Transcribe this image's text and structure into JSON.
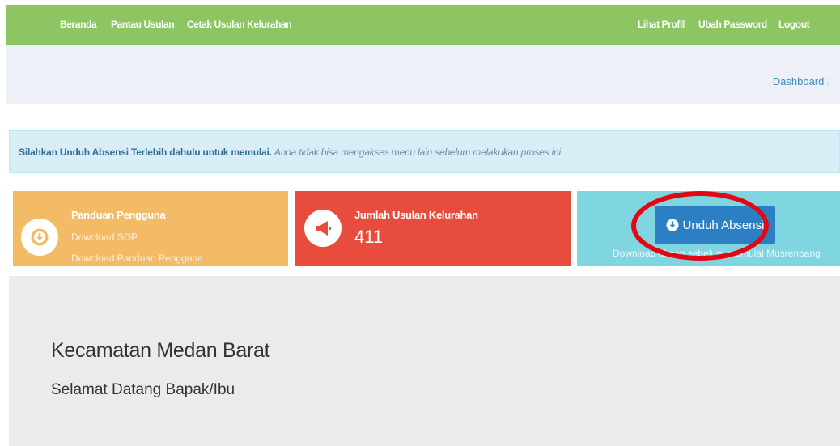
{
  "nav": {
    "left": [
      "Beranda",
      "Pantau Usulan",
      "Cetak Usulan Kelurahan"
    ],
    "right": [
      "Lihat Profil",
      "Ubah Password",
      "Logout"
    ]
  },
  "breadcrumb": {
    "current": "Dashboard",
    "separator": "/"
  },
  "alert": {
    "strong": "Silahkan Unduh Absensi Terlebih dahulu untuk memulai.",
    "note": "Anda tidak bisa mengakses menu lain sebelum melakukan proses ini"
  },
  "cards": {
    "guide": {
      "title": "Panduan Pengguna",
      "links": [
        "Download SOP",
        "Download Panduan Pengguna"
      ],
      "icon": "download-circle-icon"
    },
    "proposals": {
      "title": "Jumlah Usulan Kelurahan",
      "count": "411",
      "icon": "megaphone-icon"
    },
    "attendance": {
      "button_label": "Unduh Absensi",
      "caption": "Download absen sebelum memulai Musrenbang",
      "icon": "download-circle-icon"
    }
  },
  "welcome": {
    "title": "Kecamatan Medan Barat",
    "subtitle": "Selamat Datang Bapak/Ibu"
  },
  "colors": {
    "navbar": "#8dc563",
    "orange": "#f3bb66",
    "red": "#e74c3c",
    "cyan": "#7fd6e1",
    "button": "#2d7fc3",
    "highlight": "#e30613"
  }
}
